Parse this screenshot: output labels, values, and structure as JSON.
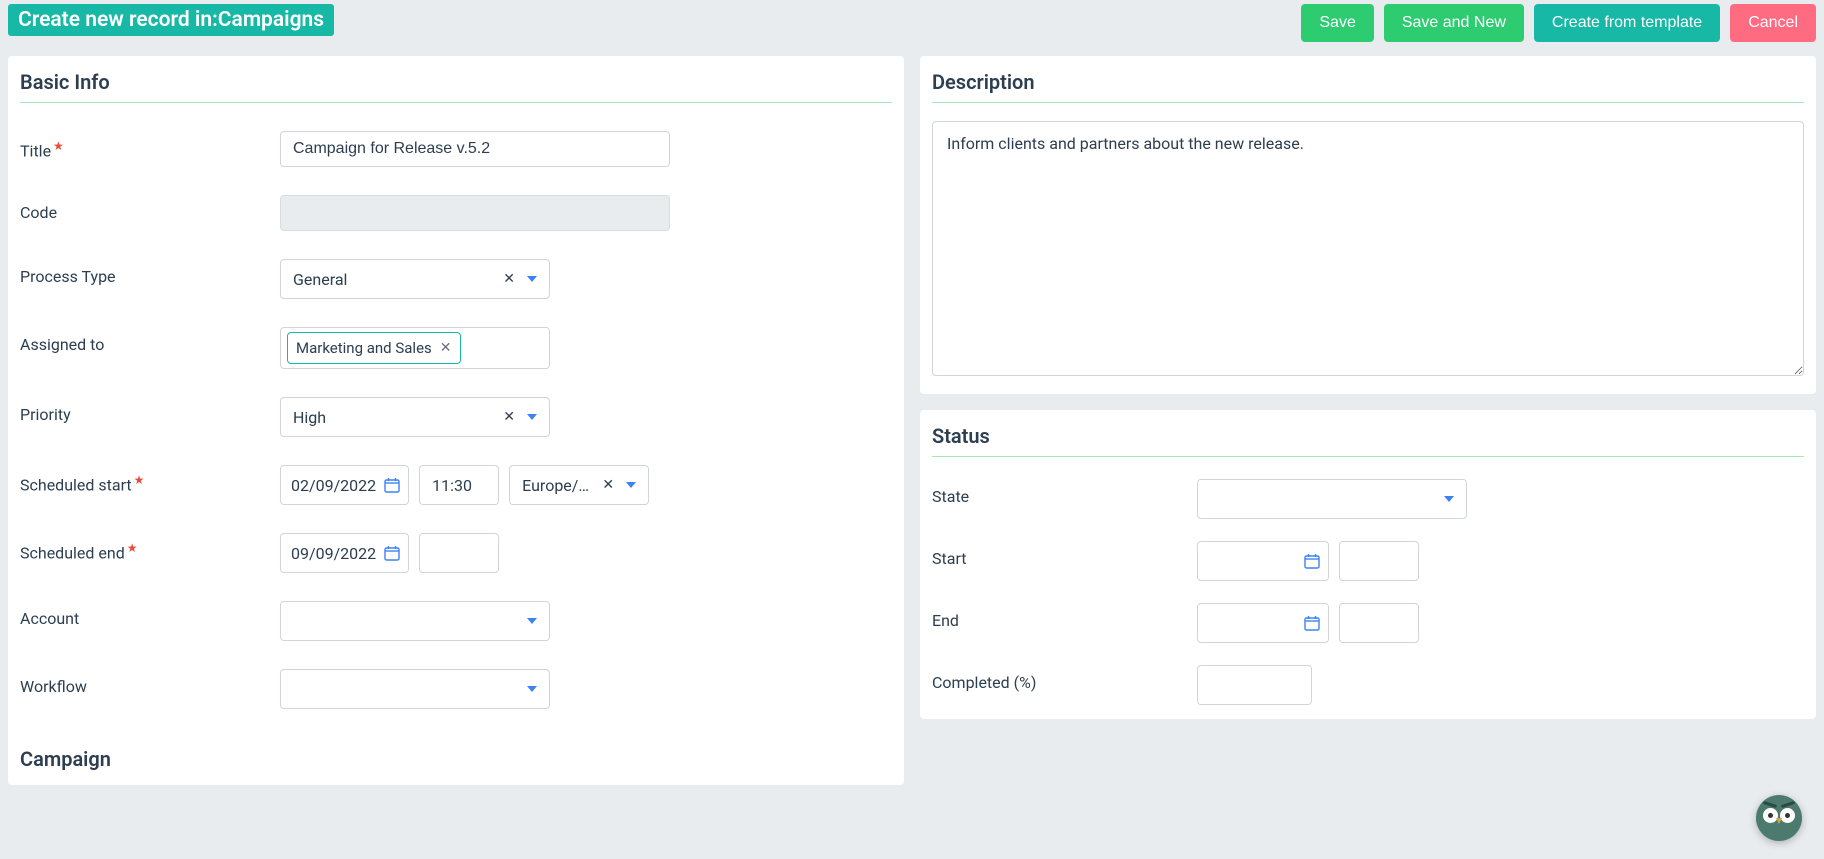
{
  "header": {
    "title": "Create new record in:Campaigns",
    "save": "Save",
    "save_new": "Save and New",
    "create_template": "Create from template",
    "cancel": "Cancel"
  },
  "basic": {
    "section": "Basic Info",
    "title_label": "Title",
    "title_value": "Campaign for Release v.5.2",
    "code_label": "Code",
    "code_value": "",
    "process_type_label": "Process Type",
    "process_type_value": "General",
    "assigned_label": "Assigned to",
    "assigned_chip": "Marketing and Sales",
    "priority_label": "Priority",
    "priority_value": "High",
    "sched_start_label": "Scheduled start",
    "sched_start_date": "02/09/2022",
    "sched_start_time": "11:30",
    "sched_start_tz": "Europe/Ath…",
    "sched_end_label": "Scheduled end",
    "sched_end_date": "09/09/2022",
    "sched_end_time": "",
    "account_label": "Account",
    "account_value": "",
    "workflow_label": "Workflow",
    "workflow_value": "",
    "campaign_section": "Campaign"
  },
  "description": {
    "section": "Description",
    "value": "Inform clients and partners about the new release."
  },
  "status": {
    "section": "Status",
    "state_label": "State",
    "state_value": "",
    "start_label": "Start",
    "start_date": "",
    "start_time": "",
    "end_label": "End",
    "end_date": "",
    "end_time": "",
    "completed_label": "Completed (%)",
    "completed_value": ""
  }
}
